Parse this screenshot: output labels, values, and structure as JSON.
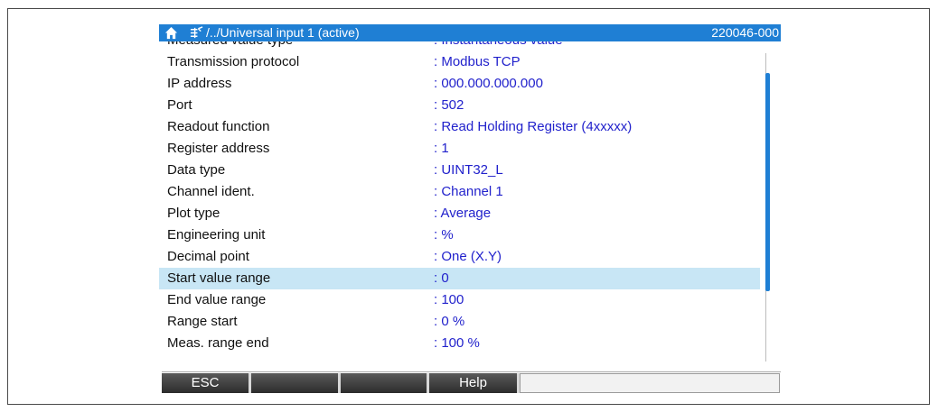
{
  "titlebar": {
    "path": "/../Universal input 1 (active)",
    "code": "220046-000"
  },
  "rows": [
    {
      "label": "Measured value type",
      "value": ": Instantaneous value"
    },
    {
      "label": "Transmission protocol",
      "value": ": Modbus TCP"
    },
    {
      "label": "IP address",
      "value": ": 000.000.000.000"
    },
    {
      "label": "Port",
      "value": ": 502"
    },
    {
      "label": "Readout function",
      "value": ": Read Holding Register (4xxxxx)"
    },
    {
      "label": "Register address",
      "value": ": 1"
    },
    {
      "label": "Data type",
      "value": ": UINT32_L"
    },
    {
      "label": "Channel ident.",
      "value": ": Channel 1"
    },
    {
      "label": "Plot type",
      "value": ": Average"
    },
    {
      "label": "Engineering unit",
      "value": ": %"
    },
    {
      "label": "Decimal point",
      "value": ": One (X.Y)"
    },
    {
      "label": "Start value range",
      "value": ": 0"
    },
    {
      "label": "End value range",
      "value": ": 100"
    },
    {
      "label": "Range start",
      "value": ": 0 %"
    },
    {
      "label": "Meas. range end",
      "value": ": 100 %"
    }
  ],
  "selected_row": "Start value range",
  "softkeys": {
    "esc": "ESC",
    "key2": "",
    "key3": "",
    "help": "Help",
    "key5": ""
  },
  "colors": {
    "titlebar": "#1f7fd4",
    "value_text": "#2222cc",
    "selection": "#c8e6f5"
  }
}
